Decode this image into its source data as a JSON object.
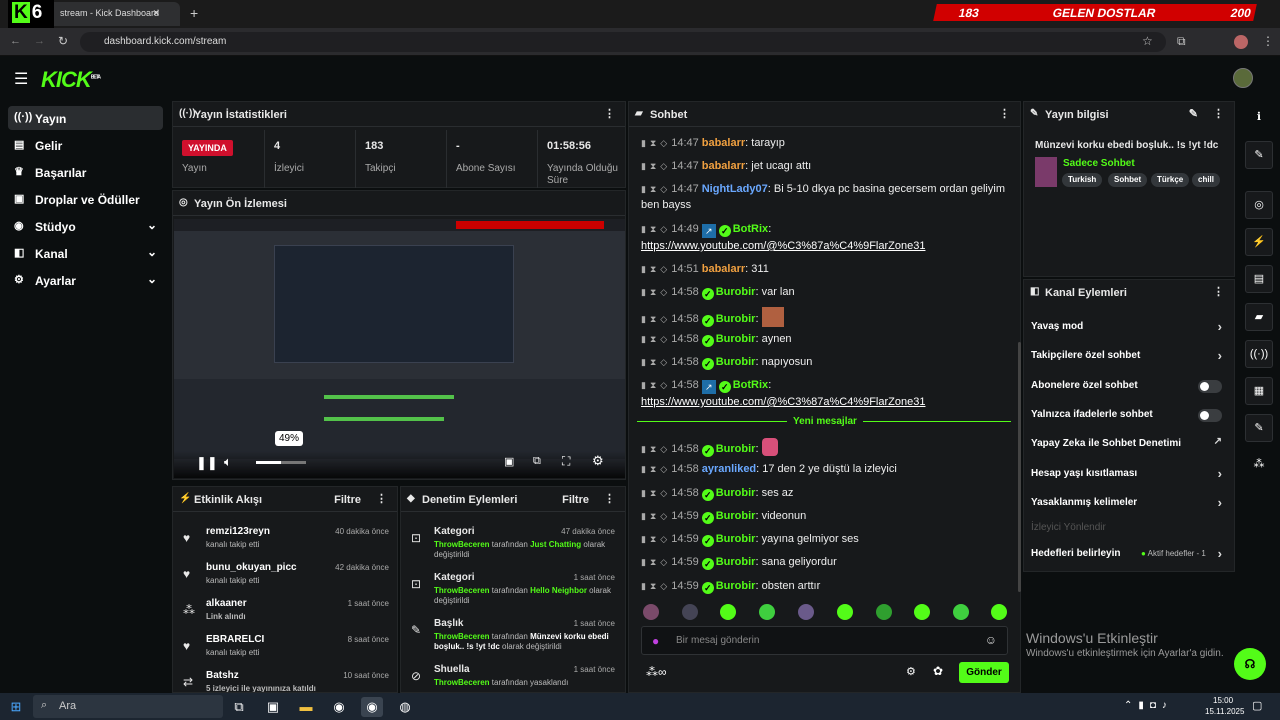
{
  "browser": {
    "tab_title": "stream - Kick Dashboard",
    "tab_logo_number": "6",
    "url": "dashboard.kick.com/stream",
    "overlay_banner": {
      "left": "183",
      "title": "GELEN DOSTLAR",
      "right": "200"
    }
  },
  "brand": {
    "logo": "KICK",
    "beta": "BETA"
  },
  "sidebar": {
    "items": [
      {
        "label": "Yayın",
        "icon": "broadcast-icon"
      },
      {
        "label": "Gelir",
        "icon": "revenue-icon"
      },
      {
        "label": "Başarılar",
        "icon": "trophy-icon"
      },
      {
        "label": "Droplar ve Ödüller",
        "icon": "gift-icon"
      },
      {
        "label": "Stüdyo",
        "icon": "studio-icon"
      },
      {
        "label": "Kanal",
        "icon": "channel-icon"
      },
      {
        "label": "Ayarlar",
        "icon": "gear-icon"
      }
    ]
  },
  "stats": {
    "title": "Yayın İstatistikleri",
    "live_badge": "YAYINDA",
    "live_label": "Yayın",
    "viewers_value": "4",
    "viewers_label": "İzleyici",
    "followers_value": "183",
    "followers_label": "Takipçi",
    "subs_value": "-",
    "subs_label": "Abone Sayısı",
    "uptime_value": "01:58:56",
    "uptime_label": "Yayında Olduğu Süre"
  },
  "preview": {
    "title": "Yayın Ön İzlemesi",
    "volume_tooltip": "49%",
    "volume_level": 0.49
  },
  "activity": {
    "title": "Etkinlik Akışı",
    "filter": "Filtre",
    "items": [
      {
        "user": "remzi123reyn",
        "sub": "kanalı takip etti",
        "time": "40 dakika önce"
      },
      {
        "user": "bunu_okuyan_picc",
        "sub": "kanalı takip etti",
        "time": "42 dakika önce"
      },
      {
        "user": "alkaaner",
        "sub": "Link alındı",
        "time": "1 saat önce"
      },
      {
        "user": "EBRARELCI",
        "sub": "kanalı takip etti",
        "time": "8 saat önce"
      },
      {
        "user": "Batshz",
        "sub": "5 izleyici ile yayınınıza katıldı",
        "time": "10 saat önce"
      }
    ]
  },
  "moderation": {
    "title": "Denetim Eylemleri",
    "filter": "Filtre",
    "items": [
      {
        "title": "Kategori",
        "actor": "ThrowBeceren",
        "mid": " tarafından ",
        "target": "Just Chatting",
        "end": " olarak değiştirildi",
        "time": "47 dakika önce"
      },
      {
        "title": "Kategori",
        "actor": "ThrowBeceren",
        "mid": " tarafından ",
        "target": "Hello Neighbor",
        "end": " olarak değiştirildi",
        "time": "1 saat önce"
      },
      {
        "title": "Başlık",
        "actor": "ThrowBeceren",
        "mid": " tarafından ",
        "target": "Münzevi korku ebedi boşluk.. !s !yt !dc",
        "end": " olarak değiştirildi",
        "time": "1 saat önce"
      },
      {
        "title": "Shuella",
        "actor": "ThrowBeceren",
        "mid": " tarafından yasaklandı",
        "target": "",
        "end": "",
        "time": "1 saat önce"
      }
    ]
  },
  "chat": {
    "title": "Sohbet",
    "new_messages": "Yeni mesajlar",
    "input_placeholder": "Bir mesaj gönderin",
    "send": "Gönder",
    "messages": [
      {
        "time": "14:47",
        "user": "babalarr",
        "color": "#f0a040",
        "text": ": tarayıp"
      },
      {
        "time": "14:47",
        "user": "babalarr",
        "color": "#f0a040",
        "text": ": jet ucagı attı"
      },
      {
        "time": "14:47",
        "user": "NightLady07",
        "color": "#6aa8ff",
        "text": ": Bi 5-10 dkya pc basina gecersem ordan geliyim ben bayss"
      },
      {
        "time": "14:49",
        "user": "BotRix",
        "color": "#53fc18",
        "text": ":",
        "link": "https://www.youtube.com/@%C3%87a%C4%9FlarZone31"
      },
      {
        "time": "14:51",
        "user": "babalarr",
        "color": "#f0a040",
        "text": ": 311"
      },
      {
        "time": "14:58",
        "user": "Burobir",
        "color": "#53fc18",
        "text": ": var lan"
      },
      {
        "time": "14:58",
        "user": "Burobir",
        "color": "#53fc18",
        "text": ":"
      },
      {
        "time": "14:58",
        "user": "Burobir",
        "color": "#53fc18",
        "text": ": aynen"
      },
      {
        "time": "14:58",
        "user": "Burobir",
        "color": "#53fc18",
        "text": ": napıyosun"
      },
      {
        "time": "14:58",
        "user": "BotRix",
        "color": "#53fc18",
        "text": ":",
        "link": "https://www.youtube.com/@%C3%87a%C4%9FlarZone31"
      },
      {
        "time": "14:58",
        "user": "Burobir",
        "color": "#53fc18",
        "text": ":"
      },
      {
        "time": "14:58",
        "user": "ayranliked",
        "color": "#6aa8ff",
        "text": ": 17 den 2 ye düştü la izleyici"
      },
      {
        "time": "14:58",
        "user": "Burobir",
        "color": "#53fc18",
        "text": ": ses az"
      },
      {
        "time": "14:59",
        "user": "Burobir",
        "color": "#53fc18",
        "text": ": videonun"
      },
      {
        "time": "14:59",
        "user": "Burobir",
        "color": "#53fc18",
        "text": ": yayına gelmiyor ses"
      },
      {
        "time": "14:59",
        "user": "Burobir",
        "color": "#53fc18",
        "text": ": sana geliyordur"
      },
      {
        "time": "14:59",
        "user": "Burobir",
        "color": "#53fc18",
        "text": ": obsten arttır"
      }
    ]
  },
  "stream_info": {
    "title": "Yayın bilgisi",
    "stream_title": "Münzevi korku ebedi boşluk.. !s !yt !dc",
    "category": "Sadece Sohbet",
    "tags": [
      "Turkish",
      "Sohbet",
      "Türkçe",
      "chill"
    ]
  },
  "channel_actions": {
    "title": "Kanal Eylemleri",
    "items": [
      {
        "label": "Yavaş mod",
        "type": "arrow"
      },
      {
        "label": "Takipçilere özel sohbet",
        "type": "arrow"
      },
      {
        "label": "Abonelere özel sohbet",
        "type": "toggle"
      },
      {
        "label": "Yalnızca ifadelerle sohbet",
        "type": "toggle"
      },
      {
        "label": "Yapay Zeka ile Sohbet Denetimi",
        "type": "external"
      },
      {
        "label": "Hesap yaşı kısıtlaması",
        "type": "arrow"
      },
      {
        "label": "Yasaklanmış kelimeler",
        "type": "arrow"
      },
      {
        "label": "İzleyici Yönlendir",
        "type": "disabled"
      },
      {
        "label": "Hedefleri belirleyin",
        "type": "goal",
        "extra": "Aktif hedefler - 1"
      }
    ]
  },
  "windows": {
    "watermark_title": "Windows'u Etkinleştir",
    "watermark_sub": "Windows'u etkinleştirmek için Ayarlar'a gidin.",
    "search": "Ara",
    "clock_time": "15:00",
    "clock_date": "15.11.2025"
  },
  "colors": {
    "accent": "#53fc18",
    "live": "#d0102d",
    "panel": "#17191b"
  }
}
